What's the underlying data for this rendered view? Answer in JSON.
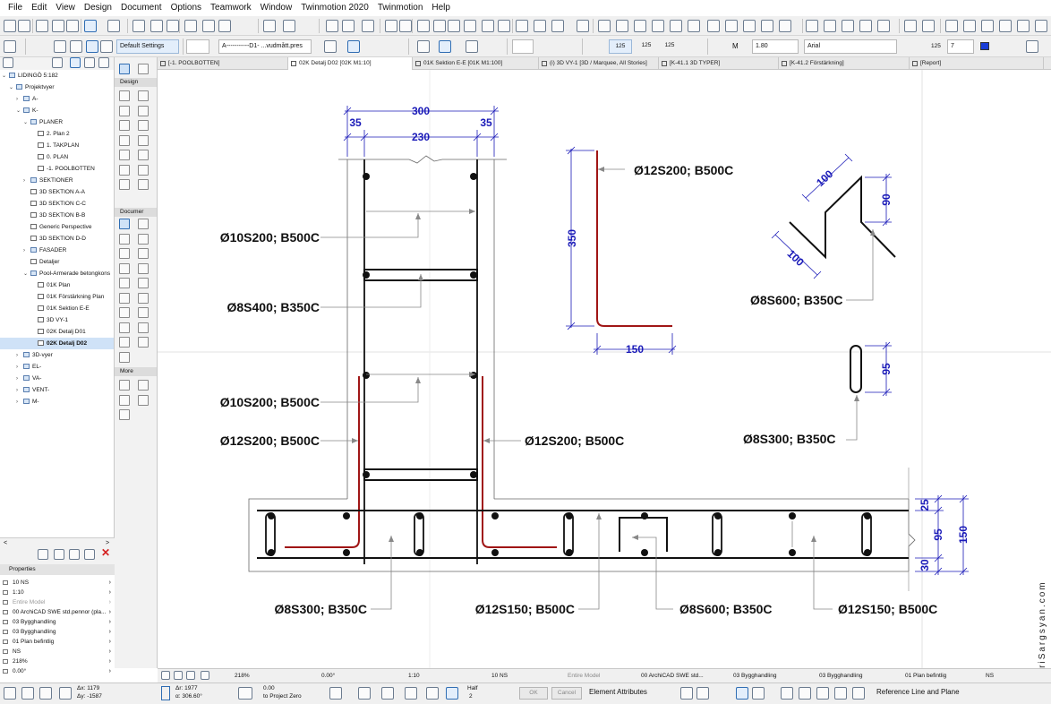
{
  "menu": [
    "File",
    "Edit",
    "View",
    "Design",
    "Document",
    "Options",
    "Teamwork",
    "Window",
    "Twinmotion 2020",
    "Twinmotion",
    "Help"
  ],
  "infobox": {
    "default_settings": "Default Settings",
    "line_label": "A-----------D1- ...vudmått.pres",
    "pen_values": [
      "125",
      "125",
      "125"
    ],
    "text_height": "1.80",
    "font": "Arial",
    "scale_prefix": "125",
    "pen_number": "7"
  },
  "tabs": [
    {
      "label": "[-1. POOLBOTTEN]",
      "active": false
    },
    {
      "label": "02K Detalj D02 [02K M1:10]",
      "active": true
    },
    {
      "label": "01K Sektion E-E [01K M1:100]",
      "active": false
    },
    {
      "label": "(i) 3D VY-1 [3D / Marquee, All Stories]",
      "active": false
    },
    {
      "label": "[K-41.1 3D TYPER]",
      "active": false
    },
    {
      "label": "[K-41.2 Förstärkning]",
      "active": false
    },
    {
      "label": "[Report]",
      "active": false
    }
  ],
  "navigator": {
    "root": "LIDINGÖ 5:182",
    "items": [
      {
        "label": "Projektvyer",
        "depth": 1,
        "arrow": "v",
        "kind": "folder"
      },
      {
        "label": "A-",
        "depth": 2,
        "arrow": ">",
        "kind": "folder"
      },
      {
        "label": "K-",
        "depth": 2,
        "arrow": "v",
        "kind": "folder"
      },
      {
        "label": "PLANER",
        "depth": 3,
        "arrow": "v",
        "kind": "folder"
      },
      {
        "label": "2. Plan 2",
        "depth": 4,
        "arrow": "",
        "kind": "view"
      },
      {
        "label": "1. TAKPLAN",
        "depth": 4,
        "arrow": "",
        "kind": "view"
      },
      {
        "label": "0. PLAN",
        "depth": 4,
        "arrow": "",
        "kind": "view"
      },
      {
        "label": "-1. POOLBOTTEN",
        "depth": 4,
        "arrow": "",
        "kind": "view"
      },
      {
        "label": "SEKTIONER",
        "depth": 3,
        "arrow": ">",
        "kind": "folder"
      },
      {
        "label": "3D SEKTION A-A",
        "depth": 3,
        "arrow": "",
        "kind": "view"
      },
      {
        "label": "3D SEKTION C-C",
        "depth": 3,
        "arrow": "",
        "kind": "view"
      },
      {
        "label": "3D SEKTION B-B",
        "depth": 3,
        "arrow": "",
        "kind": "view"
      },
      {
        "label": "Generic Perspective",
        "depth": 3,
        "arrow": "",
        "kind": "view"
      },
      {
        "label": "3D SEKTION D-D",
        "depth": 3,
        "arrow": "",
        "kind": "view"
      },
      {
        "label": "FASADER",
        "depth": 3,
        "arrow": ">",
        "kind": "folder"
      },
      {
        "label": "Detaljer",
        "depth": 3,
        "arrow": "",
        "kind": "view"
      },
      {
        "label": "Pool-Armerade betongkons",
        "depth": 3,
        "arrow": "v",
        "kind": "folder"
      },
      {
        "label": "01K Plan",
        "depth": 4,
        "arrow": "",
        "kind": "view"
      },
      {
        "label": "01K Förstärkning Plan",
        "depth": 4,
        "arrow": "",
        "kind": "view"
      },
      {
        "label": "01K Sektion E-E",
        "depth": 4,
        "arrow": "",
        "kind": "view"
      },
      {
        "label": "3D VY-1",
        "depth": 4,
        "arrow": "",
        "kind": "view"
      },
      {
        "label": "02K Detalj D01",
        "depth": 4,
        "arrow": "",
        "kind": "view"
      },
      {
        "label": "02K Detalj D02",
        "depth": 4,
        "arrow": "",
        "kind": "view",
        "selected": true
      },
      {
        "label": "3D-vyer",
        "depth": 2,
        "arrow": ">",
        "kind": "folder"
      },
      {
        "label": "EL-",
        "depth": 2,
        "arrow": ">",
        "kind": "folder"
      },
      {
        "label": "VA-",
        "depth": 2,
        "arrow": ">",
        "kind": "folder"
      },
      {
        "label": "VENT-",
        "depth": 2,
        "arrow": ">",
        "kind": "folder"
      },
      {
        "label": "M-",
        "depth": 2,
        "arrow": ">",
        "kind": "folder"
      }
    ]
  },
  "properties": {
    "header": "Properties",
    "rows": [
      "10 NS",
      "1:10",
      "Entire Model",
      "00 ArchiCAD SWE std.pennor (pla...",
      "03 Bygghandling",
      "03 Bygghandling",
      "01 Plan befintlig",
      "NS",
      "218%",
      "0.00°"
    ]
  },
  "toolbox": {
    "design": "Design",
    "document": "Documer",
    "more": "More"
  },
  "drawing": {
    "dims": {
      "d300": "300",
      "d35a": "35",
      "d35b": "35",
      "d230": "230",
      "d350": "350",
      "d150a": "150",
      "d100a": "100",
      "d100b": "100",
      "d90": "90",
      "d95a": "95",
      "d25": "25",
      "d95b": "95",
      "d150b": "150",
      "d30": "30"
    },
    "labels": {
      "l1": "Ø12S200; B500C",
      "l2": "Ø10S200; B500C",
      "l3": "Ø8S400; B350C",
      "l4": "Ø8S600; B350C",
      "l5": "Ø10S200; B500C",
      "l6": "Ø12S200; B500C",
      "l7": "Ø12S200; B500C",
      "l8": "Ø8S300; B350C",
      "l9": "Ø8S300; B350C",
      "l10": "Ø12S150; B500C",
      "l11": "Ø8S600; B350C",
      "l12": "Ø12S150; B500C"
    },
    "watermark": "© NairiSargsyan.com"
  },
  "status1": {
    "zoom": "218%",
    "angle": "0.00°",
    "scale": "1:10",
    "pen": "10 NS",
    "model": "Entire Model",
    "penset": "00 ArchiCAD SWE std...",
    "layer1": "03 Bygghandling",
    "layer2": "03 Bygghandling",
    "plan": "01 Plan befintlig",
    "ns": "NS"
  },
  "status2": {
    "dx": "Δx: 1179",
    "dy": "Δy: -1587",
    "dr": "Δr: 1977",
    "da": "α: 306.60°",
    "zero": "0.00",
    "to_zero": "to Project Zero",
    "half": "Half",
    "two": "2",
    "ok": "OK",
    "cancel": "Cancel",
    "element_attributes": "Element Attributes",
    "reference_line": "Reference Line and Plane"
  },
  "colors": {
    "dimension": "#1a1ab8",
    "rebar_red": "#a01616",
    "accent": "#2f6db3"
  }
}
